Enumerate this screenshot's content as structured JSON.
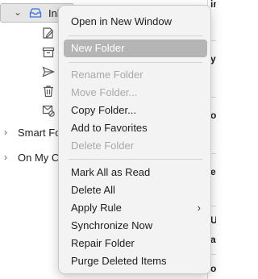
{
  "sidebar": {
    "inbox_label": "Inb",
    "smart_folders_label": "Smart Fo",
    "on_my_computer_label": "On My C",
    "subfolder_icons": [
      "drafts-icon",
      "archive-icon",
      "sent-icon",
      "trash-icon",
      "junk-icon"
    ]
  },
  "right_strip": {
    "labels": [
      "inf",
      "y",
      "o",
      "e",
      "U",
      "a",
      "o",
      "e"
    ]
  },
  "context_menu": {
    "open_in_new_window": "Open in New Window",
    "new_folder": "New Folder",
    "rename_folder": "Rename Folder",
    "move_folder": "Move Folder...",
    "copy_folder": "Copy Folder...",
    "add_to_favorites": "Add to Favorites",
    "delete_folder": "Delete Folder",
    "mark_all_as_read": "Mark All as Read",
    "delete_all": "Delete All",
    "apply_rule": "Apply Rule",
    "synchronize_now": "Synchronize Now",
    "repair_folder": "Repair Folder",
    "purge_deleted_items": "Purge Deleted Items",
    "submenu_arrow": "›"
  },
  "colors": {
    "highlight": "#b5b5b5",
    "disabled_text": "#a9a9a9",
    "menu_background": "#f3f3f3",
    "inbox_icon": "#3a6fd8"
  }
}
